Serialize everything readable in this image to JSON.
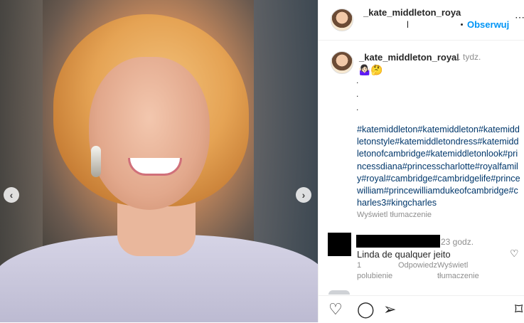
{
  "post": {
    "photo_alt": "Smiling woman with shoulder-length blonde bob, wearing a light lilac top"
  },
  "carousel": {
    "prev": "‹",
    "next": "›"
  },
  "header": {
    "username": "_kate_middleton_roya",
    "username_tail": "l",
    "follow_label": "Obserwuj",
    "more_icon": "⋯"
  },
  "caption": {
    "username": "_kate_middleton_royal",
    "time": "1 tydz.",
    "emojis": "🤷🏻‍♀️🤔",
    "dots": ".\n.\n.",
    "hashtags": "#katemiddleton#katemiddleton#katemiddletonstyle#katemiddletondress#katemiddletonofcambridge#katemiddletonlook#princessdiana#princesscharlotte#royalfamily#royal#cambridge#cambridgelife#princewilliam#princewilliamdukeofcambridge#charles3#kingcharles",
    "translate": "Wyświetl tłumaczenie"
  },
  "comment": {
    "time": "23 godz.",
    "text": "Linda de qualquer jeito",
    "likes": "1 polubienie",
    "reply": "Odpowiedz",
    "translate": "Wyświetl tłumaczenie"
  },
  "actions": {
    "like_icon": "♡",
    "comment_icon": "◯",
    "share_icon": "➢",
    "save_icon": "⌑"
  }
}
